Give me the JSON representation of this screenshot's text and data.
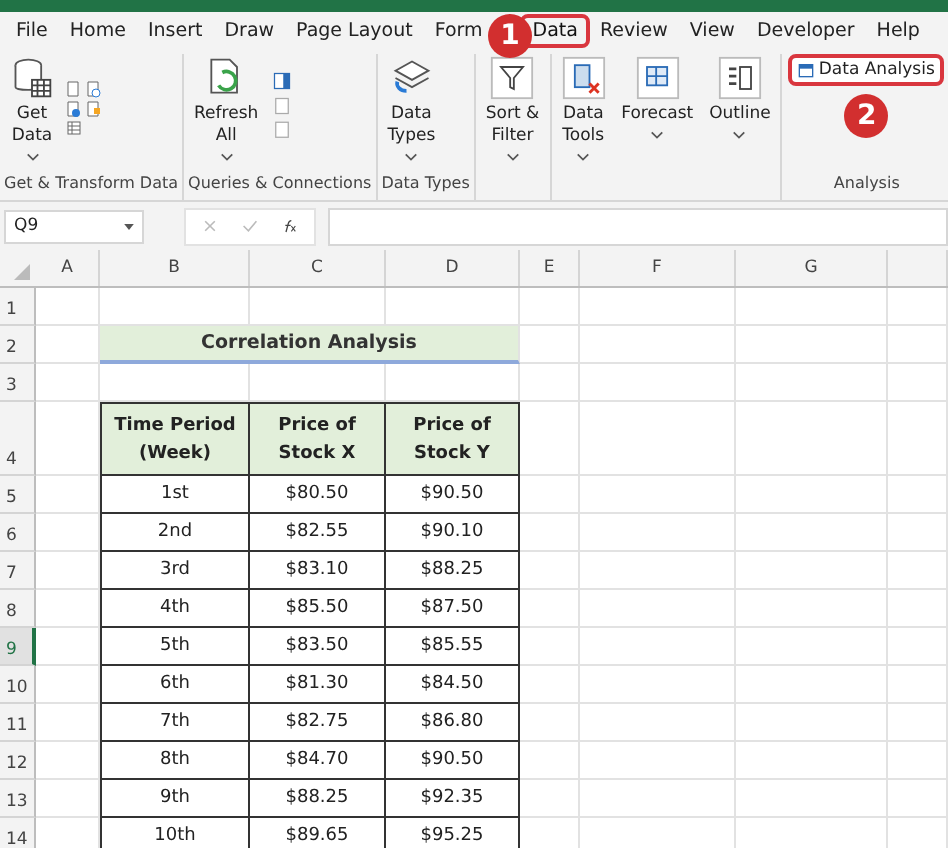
{
  "menu_tabs": [
    {
      "label": "File",
      "selected": false
    },
    {
      "label": "Home",
      "selected": false
    },
    {
      "label": "Insert",
      "selected": false
    },
    {
      "label": "Draw",
      "selected": false
    },
    {
      "label": "Page Layout",
      "selected": false
    },
    {
      "label": "Form",
      "selected": false
    },
    {
      "label": "Data",
      "selected": true
    },
    {
      "label": "Review",
      "selected": false
    },
    {
      "label": "View",
      "selected": false
    },
    {
      "label": "Developer",
      "selected": false
    },
    {
      "label": "Help",
      "selected": false
    }
  ],
  "ribbon_groups": [
    {
      "label": "Get & Transform Data",
      "buttons": [
        {
          "kind": "large",
          "lines": [
            "Get",
            "Data"
          ],
          "dropdown": true
        },
        {
          "kind": "smallgrid"
        }
      ]
    },
    {
      "label": "Queries & Connections",
      "buttons": [
        {
          "kind": "large",
          "lines": [
            "Refresh",
            "All"
          ],
          "dropdown": true
        },
        {
          "kind": "smallcol"
        }
      ]
    },
    {
      "label": "Data Types",
      "buttons": [
        {
          "kind": "large",
          "lines": [
            "Data",
            "Types"
          ],
          "dropdown": true
        }
      ]
    },
    {
      "buttons": [
        {
          "kind": "large",
          "lines": [
            "Sort &",
            "Filter"
          ],
          "dropdown": true
        }
      ]
    },
    {
      "buttons": [
        {
          "kind": "large",
          "lines": [
            "Data",
            "Tools"
          ],
          "dropdown": true
        },
        {
          "kind": "large",
          "lines": [
            "Forecast"
          ],
          "dropdown": true
        },
        {
          "kind": "large",
          "lines": [
            "Outline"
          ],
          "dropdown": true
        }
      ]
    },
    {
      "label": "Analysis",
      "buttons": [
        {
          "kind": "small",
          "lines": [
            "Data Analysis"
          ],
          "highlighted": true
        }
      ]
    }
  ],
  "callouts": [
    {
      "number": "1"
    },
    {
      "number": "2"
    }
  ],
  "name_box": "Q9",
  "columns": [
    "A",
    "B",
    "C",
    "D",
    "E",
    "F",
    "G"
  ],
  "rows": [
    {
      "number": "1",
      "selected": false
    },
    {
      "number": "2",
      "selected": false
    },
    {
      "number": "3",
      "selected": false
    },
    {
      "number": "4",
      "selected": false
    },
    {
      "number": "5",
      "selected": false
    },
    {
      "number": "6",
      "selected": false
    },
    {
      "number": "7",
      "selected": false
    },
    {
      "number": "8",
      "selected": false
    },
    {
      "number": "9",
      "selected": true
    },
    {
      "number": "10",
      "selected": false
    },
    {
      "number": "11",
      "selected": false
    },
    {
      "number": "12",
      "selected": false
    },
    {
      "number": "13",
      "selected": false
    },
    {
      "number": "14",
      "selected": false
    }
  ],
  "title": "Correlation Analysis",
  "table": {
    "columns": [
      "Time Period\n(Week)",
      "Price of\nStock X",
      "Price of\nStock Y"
    ],
    "rows": [
      [
        "1st",
        "$80.50",
        "$90.50"
      ],
      [
        "2nd",
        "$82.55",
        "$90.10"
      ],
      [
        "3rd",
        "$83.10",
        "$88.25"
      ],
      [
        "4th",
        "$85.50",
        "$87.50"
      ],
      [
        "5th",
        "$83.50",
        "$85.55"
      ],
      [
        "6th",
        "$81.30",
        "$84.50"
      ],
      [
        "7th",
        "$82.75",
        "$86.80"
      ],
      [
        "8th",
        "$84.70",
        "$90.50"
      ],
      [
        "9th",
        "$88.25",
        "$92.35"
      ],
      [
        "10th",
        "$89.65",
        "$95.25"
      ]
    ]
  }
}
